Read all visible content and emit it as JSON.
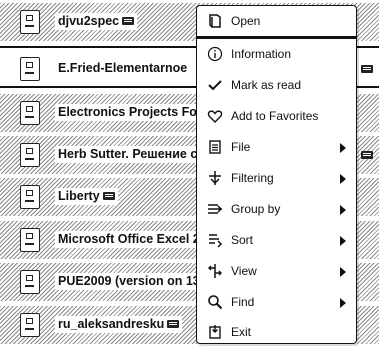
{
  "files": [
    {
      "title": "djvu2spec",
      "badge": true
    },
    {
      "title": "E.Fried-Elementarnoe",
      "badge": false,
      "ext_badge": true
    },
    {
      "title": "Electronics Projects Fo",
      "badge": false
    },
    {
      "title": "Herb Sutter. Решение с",
      "badge": false,
      "ext_badge": true
    },
    {
      "title": "Liberty",
      "badge": true
    },
    {
      "title": "Microsoft Office Excel 2",
      "badge": false
    },
    {
      "title": "PUE2009 (version on 13",
      "badge": false
    },
    {
      "title": "ru_aleksandresku",
      "badge": true
    }
  ],
  "menu": {
    "items": [
      {
        "label": "Open",
        "icon": "book-open-icon"
      },
      {
        "label": "Information",
        "icon": "info-icon"
      },
      {
        "label": "Mark as read",
        "icon": "checkmark-icon"
      },
      {
        "label": "Add to Favorites",
        "icon": "heart-icon"
      },
      {
        "label": "File",
        "icon": "file-icon",
        "submenu": true
      },
      {
        "label": "Filtering",
        "icon": "filter-icon",
        "submenu": true
      },
      {
        "label": "Group by",
        "icon": "group-icon",
        "submenu": true
      },
      {
        "label": "Sort",
        "icon": "sort-icon",
        "submenu": true
      },
      {
        "label": "View",
        "icon": "view-icon",
        "submenu": true
      },
      {
        "label": "Find",
        "icon": "search-icon",
        "submenu": true
      },
      {
        "label": "Exit",
        "icon": "exit-icon"
      }
    ]
  }
}
